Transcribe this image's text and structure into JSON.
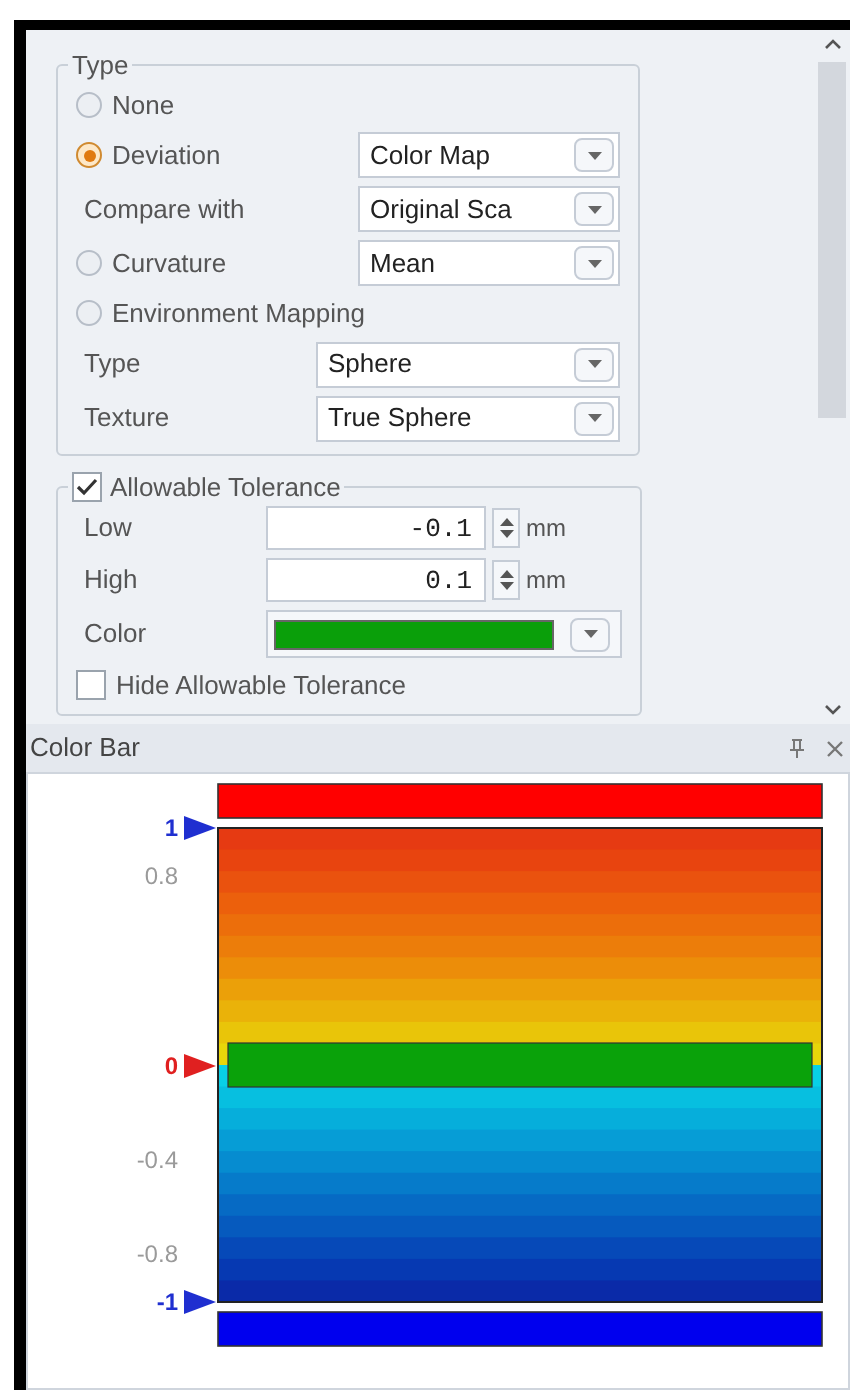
{
  "type_group": {
    "title": "Type",
    "options": [
      {
        "label": "None",
        "selected": false
      },
      {
        "label": "Deviation",
        "selected": true,
        "dropdown": "Color Map"
      },
      {
        "label": "Curvature",
        "selected": false,
        "dropdown": "Mean"
      },
      {
        "label": "Environment Mapping",
        "selected": false
      }
    ],
    "compare_with": {
      "label": "Compare with",
      "dropdown": "Original Sca"
    },
    "environment_fields": [
      {
        "label": "Type",
        "dropdown": "Sphere"
      },
      {
        "label": "Texture",
        "dropdown": "True Sphere"
      }
    ]
  },
  "tolerance_group": {
    "title": "Allowable Tolerance",
    "checked": true,
    "low": {
      "label": "Low",
      "value": "-0.1",
      "unit": "mm"
    },
    "high": {
      "label": "High",
      "value": "0.1",
      "unit": "mm"
    },
    "color": {
      "label": "Color",
      "color": "#0a9f0a"
    },
    "hide": {
      "label": "Hide Allowable Tolerance",
      "checked": false
    }
  },
  "color_bar": {
    "title": "Color Bar",
    "labels": [
      {
        "text": "1",
        "marker": true,
        "color": "#1f2fd0"
      },
      {
        "text": "0.8",
        "marker": false,
        "color": "#9a9a9a"
      },
      {
        "text": "0",
        "marker": true,
        "color": "#e02020"
      },
      {
        "text": "-0.4",
        "marker": false,
        "color": "#9a9a9a"
      },
      {
        "text": "-0.8",
        "marker": false,
        "color": "#9a9a9a"
      },
      {
        "text": "-1",
        "marker": true,
        "color": "#1f2fd0"
      }
    ]
  }
}
